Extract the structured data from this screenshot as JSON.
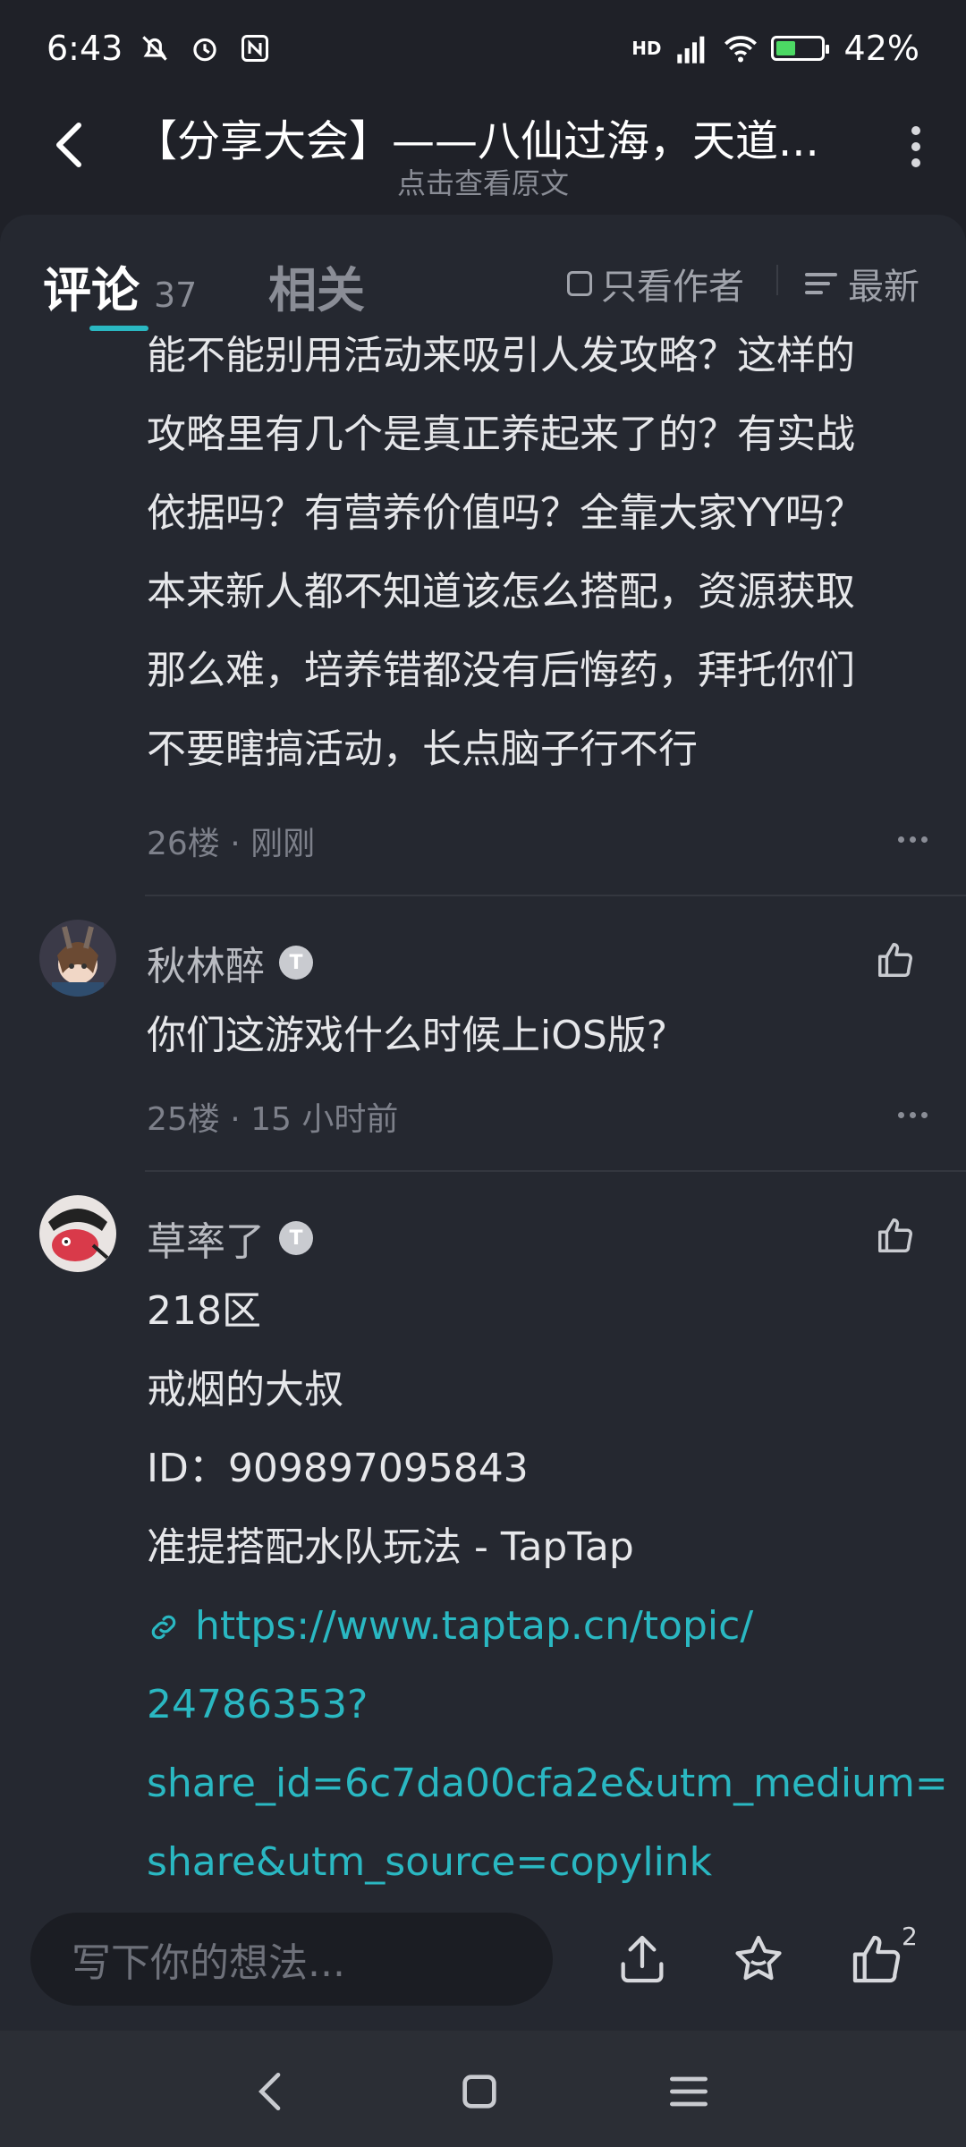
{
  "status": {
    "time": "6:43",
    "battery": "42%",
    "network": "HD"
  },
  "header": {
    "title": "【分享大会】——八仙过海，天道...",
    "subtitle": "点击查看原文"
  },
  "tabs": {
    "comments_label": "评论",
    "comments_count": "37",
    "related_label": "相关",
    "only_author": "只看作者",
    "sort": "最新"
  },
  "comments": [
    {
      "lines": [
        "能不能别用活动来吸引人发攻略？这样的",
        "攻略里有几个是真正养起来了的？有实战",
        "依据吗？有营养价值吗？全靠大家YY吗？",
        "本来新人都不知道该怎么搭配，资源获取",
        "那么难，培养错都没有后悔药，拜托你们",
        "不要瞎搞活动，长点脑子行不行"
      ],
      "meta": "26楼 · 刚刚"
    },
    {
      "user": "秋林醉",
      "badge": "T",
      "lines": [
        "你们这游戏什么时候上iOS版?"
      ],
      "meta": "25楼 · 15 小时前"
    },
    {
      "user": "草率了",
      "badge": "T",
      "lines": [
        "218区",
        "戒烟的大叔",
        "ID：909897095843",
        "准提搭配水队玩法 - TapTap"
      ],
      "link_lines": [
        "https://www.taptap.cn/topic/",
        "24786353?",
        "share_id=6c7da00cfa2e&utm_medium=",
        "share&utm_source=copylink"
      ]
    }
  ],
  "input": {
    "placeholder": "写下你的想法..."
  },
  "likes": "2",
  "colors": {
    "background": "#1f2128",
    "panel": "#252830",
    "accent": "#2ab8c2",
    "text": "#e6e7ea",
    "muted": "#7d808a"
  }
}
